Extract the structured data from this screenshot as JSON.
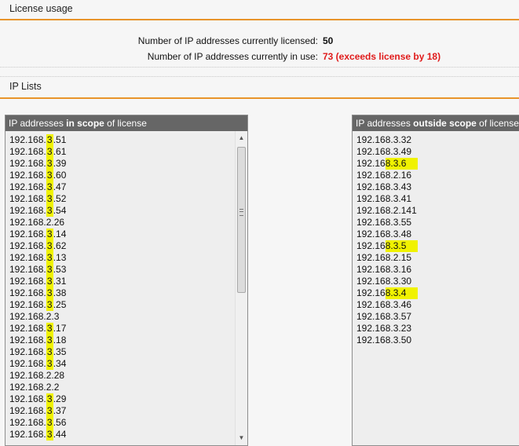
{
  "license_usage": {
    "title": "License usage",
    "licensed_label": "Number of IP addresses currently licensed:",
    "licensed_value": "50",
    "inuse_label": "Number of IP addresses currently in use:",
    "inuse_value": "73 (exceeds license by 18)"
  },
  "ip_lists": {
    "title": "IP Lists",
    "in_scope": {
      "heading_pre": "IP addresses ",
      "heading_bold": "in scope",
      "heading_post": " of license",
      "items": [
        [
          "192.168.",
          "3",
          ".51"
        ],
        [
          "192.168.",
          "3",
          ".61"
        ],
        [
          "192.168.",
          "3",
          ".39"
        ],
        [
          "192.168.",
          "3",
          ".60"
        ],
        [
          "192.168.",
          "3",
          ".47"
        ],
        [
          "192.168.",
          "3",
          ".52"
        ],
        [
          "192.168.",
          "3",
          ".54"
        ],
        [
          "192.168.2.26",
          "",
          ""
        ],
        [
          "192.168.",
          "3",
          ".14"
        ],
        [
          "192.168.",
          "3",
          ".62"
        ],
        [
          "192.168.",
          "3",
          ".13"
        ],
        [
          "192.168.",
          "3",
          ".53"
        ],
        [
          "192.168.",
          "3",
          ".31"
        ],
        [
          "192.168.",
          "3",
          ".38"
        ],
        [
          "192.168.",
          "3",
          ".25"
        ],
        [
          "192.168.2.3",
          "",
          ""
        ],
        [
          "192.168.",
          "3",
          ".17"
        ],
        [
          "192.168.",
          "3",
          ".18"
        ],
        [
          "192.168.",
          "3",
          ".35"
        ],
        [
          "192.168.",
          "3",
          ".34"
        ],
        [
          "192.168.2.28",
          "",
          ""
        ],
        [
          "192.168.2.2",
          "",
          ""
        ],
        [
          "192.168.",
          "3",
          ".29"
        ],
        [
          "192.168.",
          "3",
          ".37"
        ],
        [
          "192.168.",
          "3",
          ".56"
        ],
        [
          "192.168.",
          "3",
          ".44"
        ]
      ]
    },
    "outside_scope": {
      "heading_pre": "IP addresses ",
      "heading_bold": "outside scope",
      "heading_post": " of license",
      "items": [
        [
          "192.168.3.32",
          ""
        ],
        [
          "192.168.3.49",
          ""
        ],
        [
          "192.16",
          "8.3.6"
        ],
        [
          "192.168.2.16",
          ""
        ],
        [
          "192.168.3.43",
          ""
        ],
        [
          "192.168.3.41",
          ""
        ],
        [
          "192.168.2.141",
          ""
        ],
        [
          "192.168.3.55",
          ""
        ],
        [
          "192.168.3.48",
          ""
        ],
        [
          "192.16",
          "8.3.5"
        ],
        [
          "192.168.2.15",
          ""
        ],
        [
          "192.168.3.16",
          ""
        ],
        [
          "192.168.3.30",
          ""
        ],
        [
          "192.16",
          "8.3.4"
        ],
        [
          "192.168.3.46",
          ""
        ],
        [
          "192.168.3.57",
          ""
        ],
        [
          "192.168.3.23",
          ""
        ],
        [
          "192.168.3.50",
          ""
        ]
      ]
    }
  },
  "colors": {
    "accent": "#e8942a",
    "warning": "#e01b1b",
    "highlight": "#f0f200",
    "panel_header": "#666666"
  },
  "icons": {
    "scroll_up": "up-arrow-icon",
    "scroll_down": "down-arrow-icon"
  }
}
